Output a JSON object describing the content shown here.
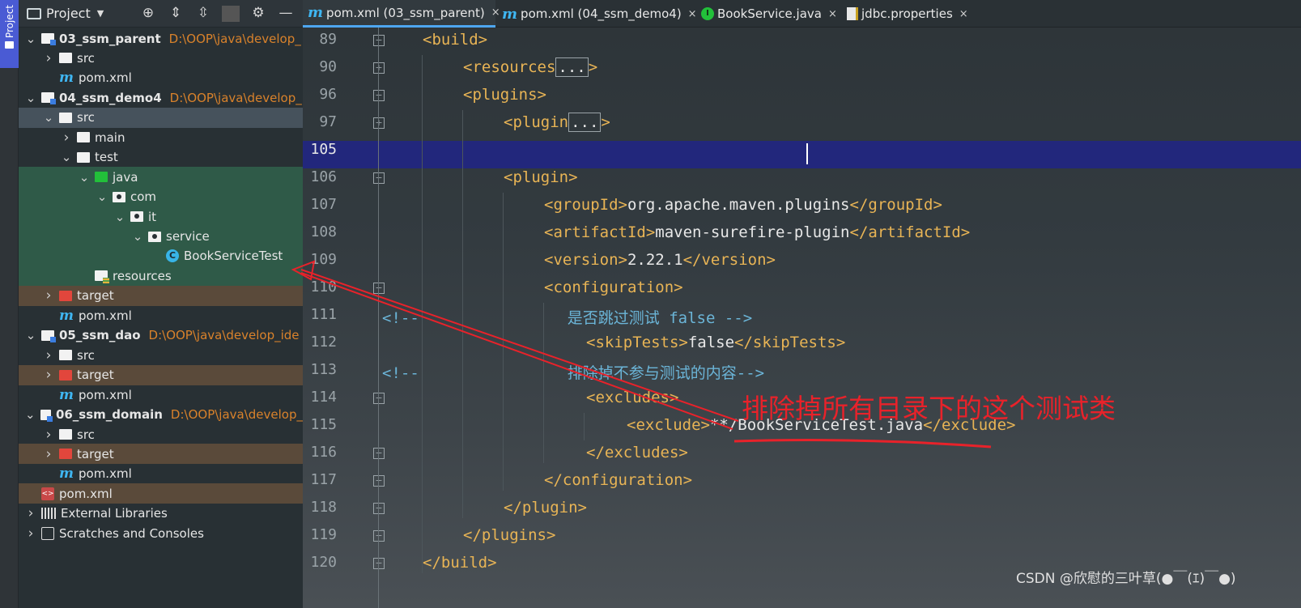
{
  "sidebar_strip": {
    "label": "Project"
  },
  "project_panel": {
    "title": "Project",
    "tree": [
      {
        "name": "03_ssm_parent",
        "path": "D:\\OOP\\java\\develop_",
        "bold": true,
        "arrow": "down",
        "icon": "module-folder-icon"
      },
      {
        "name": "src",
        "arrow": "right",
        "icon": "folder-icon"
      },
      {
        "name": "pom.xml",
        "icon": "maven-icon"
      },
      {
        "name": "04_ssm_demo4",
        "path": "D:\\OOP\\java\\develop_",
        "bold": true,
        "arrow": "down",
        "icon": "module-folder-icon"
      },
      {
        "name": "src",
        "arrow": "down",
        "icon": "folder-icon"
      },
      {
        "name": "main",
        "arrow": "right",
        "icon": "folder-icon"
      },
      {
        "name": "test",
        "arrow": "down",
        "icon": "folder-icon"
      },
      {
        "name": "java",
        "arrow": "down",
        "icon": "test-source-folder-icon"
      },
      {
        "name": "com",
        "arrow": "down",
        "icon": "package-icon"
      },
      {
        "name": "it",
        "arrow": "down",
        "icon": "package-icon"
      },
      {
        "name": "service",
        "arrow": "down",
        "icon": "package-icon"
      },
      {
        "name": "BookServiceTest",
        "icon": "class-icon"
      },
      {
        "name": "resources",
        "icon": "resources-folder-icon"
      },
      {
        "name": "target",
        "arrow": "right",
        "icon": "excluded-folder-icon"
      },
      {
        "name": "pom.xml",
        "icon": "maven-icon"
      },
      {
        "name": "05_ssm_dao",
        "path": "D:\\OOP\\java\\develop_ide",
        "bold": true,
        "arrow": "down",
        "icon": "module-folder-icon"
      },
      {
        "name": "src",
        "arrow": "right",
        "icon": "folder-icon"
      },
      {
        "name": "target",
        "arrow": "right",
        "icon": "excluded-folder-icon"
      },
      {
        "name": "pom.xml",
        "icon": "maven-icon"
      },
      {
        "name": "06_ssm_domain",
        "path": "D:\\OOP\\java\\develop_",
        "bold": true,
        "arrow": "down",
        "icon": "module-folder-icon"
      },
      {
        "name": "src",
        "arrow": "right",
        "icon": "folder-icon"
      },
      {
        "name": "target",
        "arrow": "right",
        "icon": "excluded-folder-icon"
      },
      {
        "name": "pom.xml",
        "icon": "maven-icon"
      },
      {
        "name": "pom.xml",
        "icon": "xml-icon"
      },
      {
        "name": "External Libraries",
        "arrow": "right",
        "icon": "library-icon"
      },
      {
        "name": "Scratches and Consoles",
        "arrow": "right",
        "icon": "scratch-icon"
      }
    ]
  },
  "tabs": [
    {
      "label": "pom.xml (03_ssm_parent)",
      "icon": "maven-icon",
      "close": "×"
    },
    {
      "label": "pom.xml (04_ssm_demo4)",
      "icon": "maven-icon",
      "close": "×"
    },
    {
      "label": "BookService.java",
      "icon": "interface-icon",
      "close": "×"
    },
    {
      "label": "jdbc.properties",
      "icon": "properties-icon",
      "close": "×"
    }
  ],
  "editor": {
    "line_numbers": [
      "89",
      "90",
      "96",
      "97",
      "105",
      "106",
      "107",
      "108",
      "109",
      "110",
      "111",
      "112",
      "113",
      "114",
      "115",
      "116",
      "117",
      "118",
      "119",
      "120"
    ],
    "code": {
      "l89": "<build>",
      "l90_open": "<resources",
      "l90_fold": "...",
      "l90_close": ">",
      "l96": "<plugins>",
      "l97_open": "<plugin",
      "l97_fold": "...",
      "l97_close": ">",
      "l106": "<plugin>",
      "l107_open": "<groupId>",
      "l107_val": "org.apache.maven.plugins",
      "l107_close": "</groupId>",
      "l108_open": "<artifactId>",
      "l108_val": "maven-surefire-plugin",
      "l108_close": "</artifactId>",
      "l109_open": "<version>",
      "l109_val": "2.22.1",
      "l109_close": "</version>",
      "l110": "<configuration>",
      "l111": "<!--                是否跳过测试 false -->",
      "l112_open": "<skipTests>",
      "l112_val": "false",
      "l112_close": "</skipTests>",
      "l113": "<!--                排除掉不参与测试的内容-->",
      "l114": "<excludes>",
      "l115_open": "<exclude>",
      "l115_val": "**/BookServiceTest.java",
      "l115_close": "</exclude>",
      "l116": "</excludes>",
      "l117": "</configuration>",
      "l118": "</plugin>",
      "l119": "</plugins>",
      "l120": "</build>"
    }
  },
  "annotation": {
    "text": "排除掉所有目录下的这个测试类",
    "color": "#e8222a"
  },
  "watermark": "CSDN @欣慰的三叶草(●￣(ｴ)￣●)"
}
